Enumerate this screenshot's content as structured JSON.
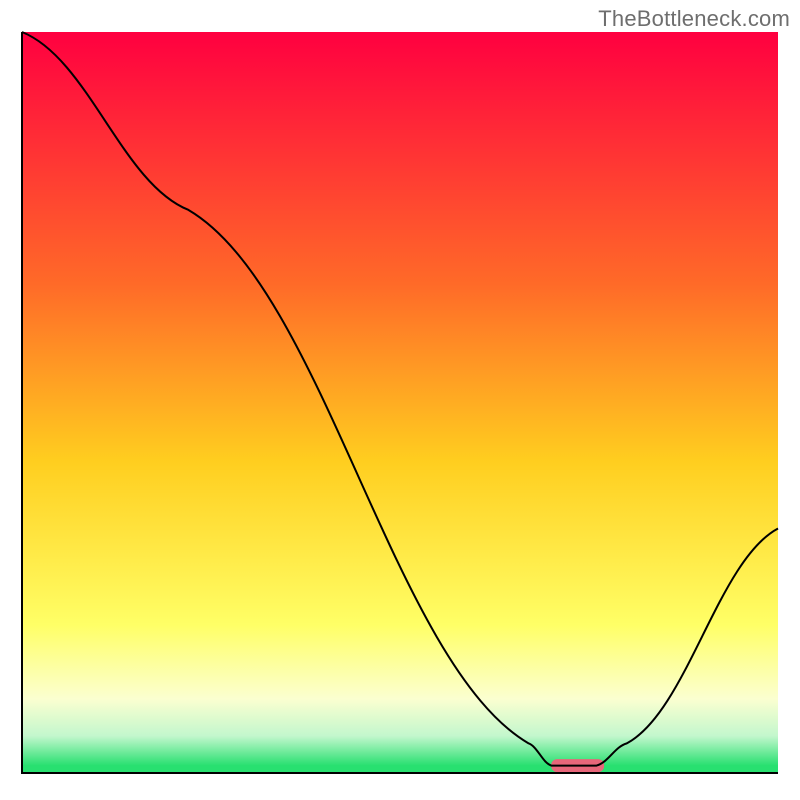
{
  "watermark": "TheBottleneck.com",
  "colors": {
    "gradient_top": "#ff0040",
    "gradient_mid_upper": "#ff6a28",
    "gradient_mid": "#ffce1f",
    "gradient_mid_lower": "#ffff66",
    "gradient_low": "#fbffd0",
    "gradient_green_pale": "#c3f7cd",
    "gradient_green": "#28e070",
    "curve_stroke": "#000000",
    "marker_fill": "#e8667a"
  },
  "chart_data": {
    "type": "line",
    "title": "",
    "xlabel": "",
    "ylabel": "",
    "xlim": [
      0,
      100
    ],
    "ylim": [
      0,
      100
    ],
    "grid": false,
    "legend": false,
    "note": "No axis ticks or numeric labels are rendered; x/y are normalized 0–100 read from geometry.",
    "series": [
      {
        "name": "bottleneck-curve",
        "points": [
          {
            "x": 0,
            "y": 100
          },
          {
            "x": 22,
            "y": 76
          },
          {
            "x": 67,
            "y": 4
          },
          {
            "x": 70,
            "y": 1
          },
          {
            "x": 76,
            "y": 1
          },
          {
            "x": 80,
            "y": 4
          },
          {
            "x": 100,
            "y": 33
          }
        ]
      }
    ],
    "marker": {
      "name": "optimal-range",
      "x_start": 70,
      "x_end": 77,
      "y": 1
    },
    "gradient_bands_pct_from_top": [
      {
        "color": "#ff0040",
        "stop": 0
      },
      {
        "color": "#ff6a28",
        "stop": 34
      },
      {
        "color": "#ffce1f",
        "stop": 58
      },
      {
        "color": "#ffff66",
        "stop": 80
      },
      {
        "color": "#fbffd0",
        "stop": 90
      },
      {
        "color": "#c3f7cd",
        "stop": 95
      },
      {
        "color": "#28e070",
        "stop": 99
      }
    ]
  }
}
